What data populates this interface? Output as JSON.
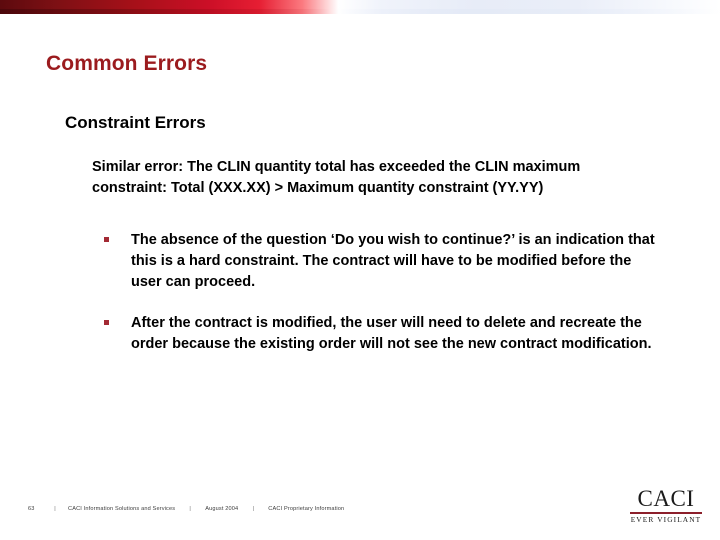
{
  "slide": {
    "title": "Common Errors",
    "subtitle": "Constraint Errors",
    "lead_paragraph": "Similar error:  The CLIN quantity total has exceeded the CLIN maximum constraint:  Total (XXX.XX) > Maximum quantity constraint (YY.YY)",
    "bullets": [
      {
        "marker": "square-bullet-icon",
        "text": "The absence of the question ‘Do you wish to continue?’ is an indication that this is a hard constraint.  The contract will have to be modified before the user can proceed."
      },
      {
        "marker": "square-bullet-icon",
        "text": "After the contract is modified, the user will need to delete and recreate the order because the existing order will not see the new contract modification."
      }
    ]
  },
  "footer": {
    "page_number": "63",
    "separator": "|",
    "organization": "CACI Information Solutions and Services",
    "date": "August 2004",
    "notice": "CACI Proprietary Information"
  },
  "logo": {
    "wordmark": "CACI",
    "tagline": "EVER VIGILANT"
  },
  "colors": {
    "title_red": "#9b1b1e",
    "bullet_red": "#a32a34",
    "logo_rule_red": "#8c1f2b",
    "banner_dark_red": "#5d0a0e",
    "banner_bright_red": "#cc0f27",
    "banner_light_blue": "#e7ecf7",
    "body_text": "#000000",
    "footer_text": "#3c3c3c",
    "background": "#ffffff"
  }
}
